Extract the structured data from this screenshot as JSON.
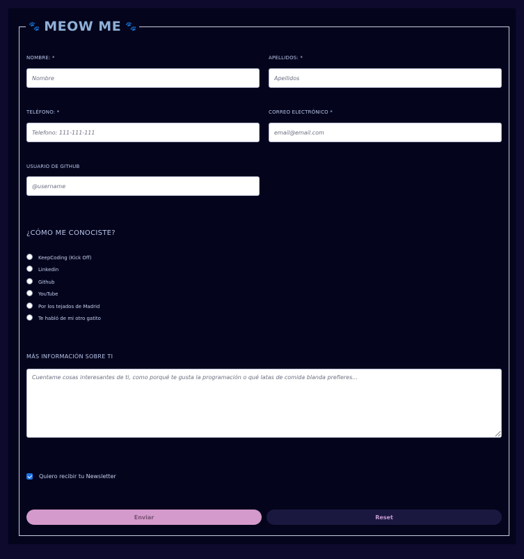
{
  "form": {
    "title": "MEOW ME",
    "paw_icon": "🐾",
    "fields": {
      "nombre": {
        "label": "NOMBRE: *",
        "placeholder": "Nombre"
      },
      "apellidos": {
        "label": "APELLIDOS: *",
        "placeholder": "Apellidos"
      },
      "telefono": {
        "label": "TELÉFONO: *",
        "placeholder": "Telefono: 111-111-111"
      },
      "correo": {
        "label": "CORREO ELECTRÓNICO *",
        "placeholder": "email@email.com"
      },
      "github": {
        "label": "USUARIO DE GITHUB",
        "placeholder": "@username"
      }
    },
    "how_title": "¿CÓMO ME CONOCISTE?",
    "how_options": [
      "KeepCoding (Kick Off)",
      "Linkedin",
      "Github",
      "YouTube",
      "Por los tejados de Madrid",
      "Te habló de mi otro gatito"
    ],
    "more_title": "MÁS INFORMACIÓN SOBRE TI",
    "more_placeholder": "Cuentame cosas interesantes de ti, como porqué te gusta la programación o qué latas de comida blanda prefieres...",
    "newsletter_label": "Quiero recibir tu Newsletter",
    "newsletter_checked": true,
    "send_label": "Enviar",
    "reset_label": "Reset"
  },
  "colors": {
    "background": "#0e0a2e",
    "panel": "#04041c",
    "send_button": "#d49acb",
    "reset_button": "#1b1840",
    "accent_text": "#8fb0d6"
  }
}
